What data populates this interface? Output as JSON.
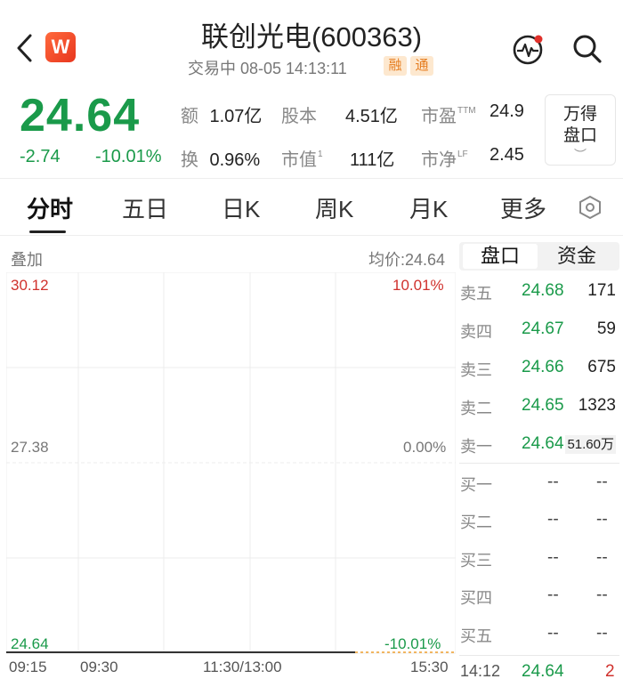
{
  "header": {
    "title": "联创光电(600363)",
    "subtitle": "交易中  08-05 14:13:11",
    "tags": [
      "融",
      "通"
    ]
  },
  "quote": {
    "price": "24.64",
    "change": "-2.74",
    "change_pct": "-10.01%",
    "stats": [
      {
        "label": "额",
        "value": "1.07亿"
      },
      {
        "label": "股本",
        "value": "4.51亿"
      },
      {
        "label": "市盈",
        "sup": "TTM",
        "value": "24.9"
      },
      {
        "label": "换",
        "value": "0.96%"
      },
      {
        "label": "市值",
        "sup": "1",
        "value": "111亿"
      },
      {
        "label": "市净",
        "sup": "LF",
        "value": "2.45"
      }
    ],
    "wande_button": {
      "line1": "万得",
      "line2": "盘口",
      "chevron": "︶"
    }
  },
  "tabs": [
    "分时",
    "五日",
    "日K",
    "周K",
    "月K",
    "更多"
  ],
  "chart": {
    "overlay_label": "叠加",
    "avg_price_label": "均价:24.64",
    "y_left": [
      "30.12",
      "27.38",
      "24.64"
    ],
    "y_right": [
      "10.01%",
      "0.00%",
      "-10.01%"
    ],
    "x_labels": [
      "09:15",
      "09:30",
      "11:30/13:00",
      "15:30"
    ],
    "colors": {
      "up": "#d0312d",
      "down": "#1a9a4a",
      "neutral": "#777777"
    }
  },
  "order_book": {
    "tabs": [
      "盘口",
      "资金"
    ],
    "asks": [
      {
        "label": "卖五",
        "price": "24.68",
        "volume": "171"
      },
      {
        "label": "卖四",
        "price": "24.67",
        "volume": "59"
      },
      {
        "label": "卖三",
        "price": "24.66",
        "volume": "675"
      },
      {
        "label": "卖二",
        "price": "24.65",
        "volume": "1323"
      },
      {
        "label": "卖一",
        "price": "24.64",
        "volume": "51.60万"
      }
    ],
    "bids": [
      {
        "label": "买一",
        "price": "--",
        "volume": "--"
      },
      {
        "label": "买二",
        "price": "--",
        "volume": "--"
      },
      {
        "label": "买三",
        "price": "--",
        "volume": "--"
      },
      {
        "label": "买四",
        "price": "--",
        "volume": "--"
      },
      {
        "label": "买五",
        "price": "--",
        "volume": "--"
      }
    ],
    "last_tick": {
      "time": "14:12",
      "price": "24.64",
      "volume": "2"
    }
  }
}
